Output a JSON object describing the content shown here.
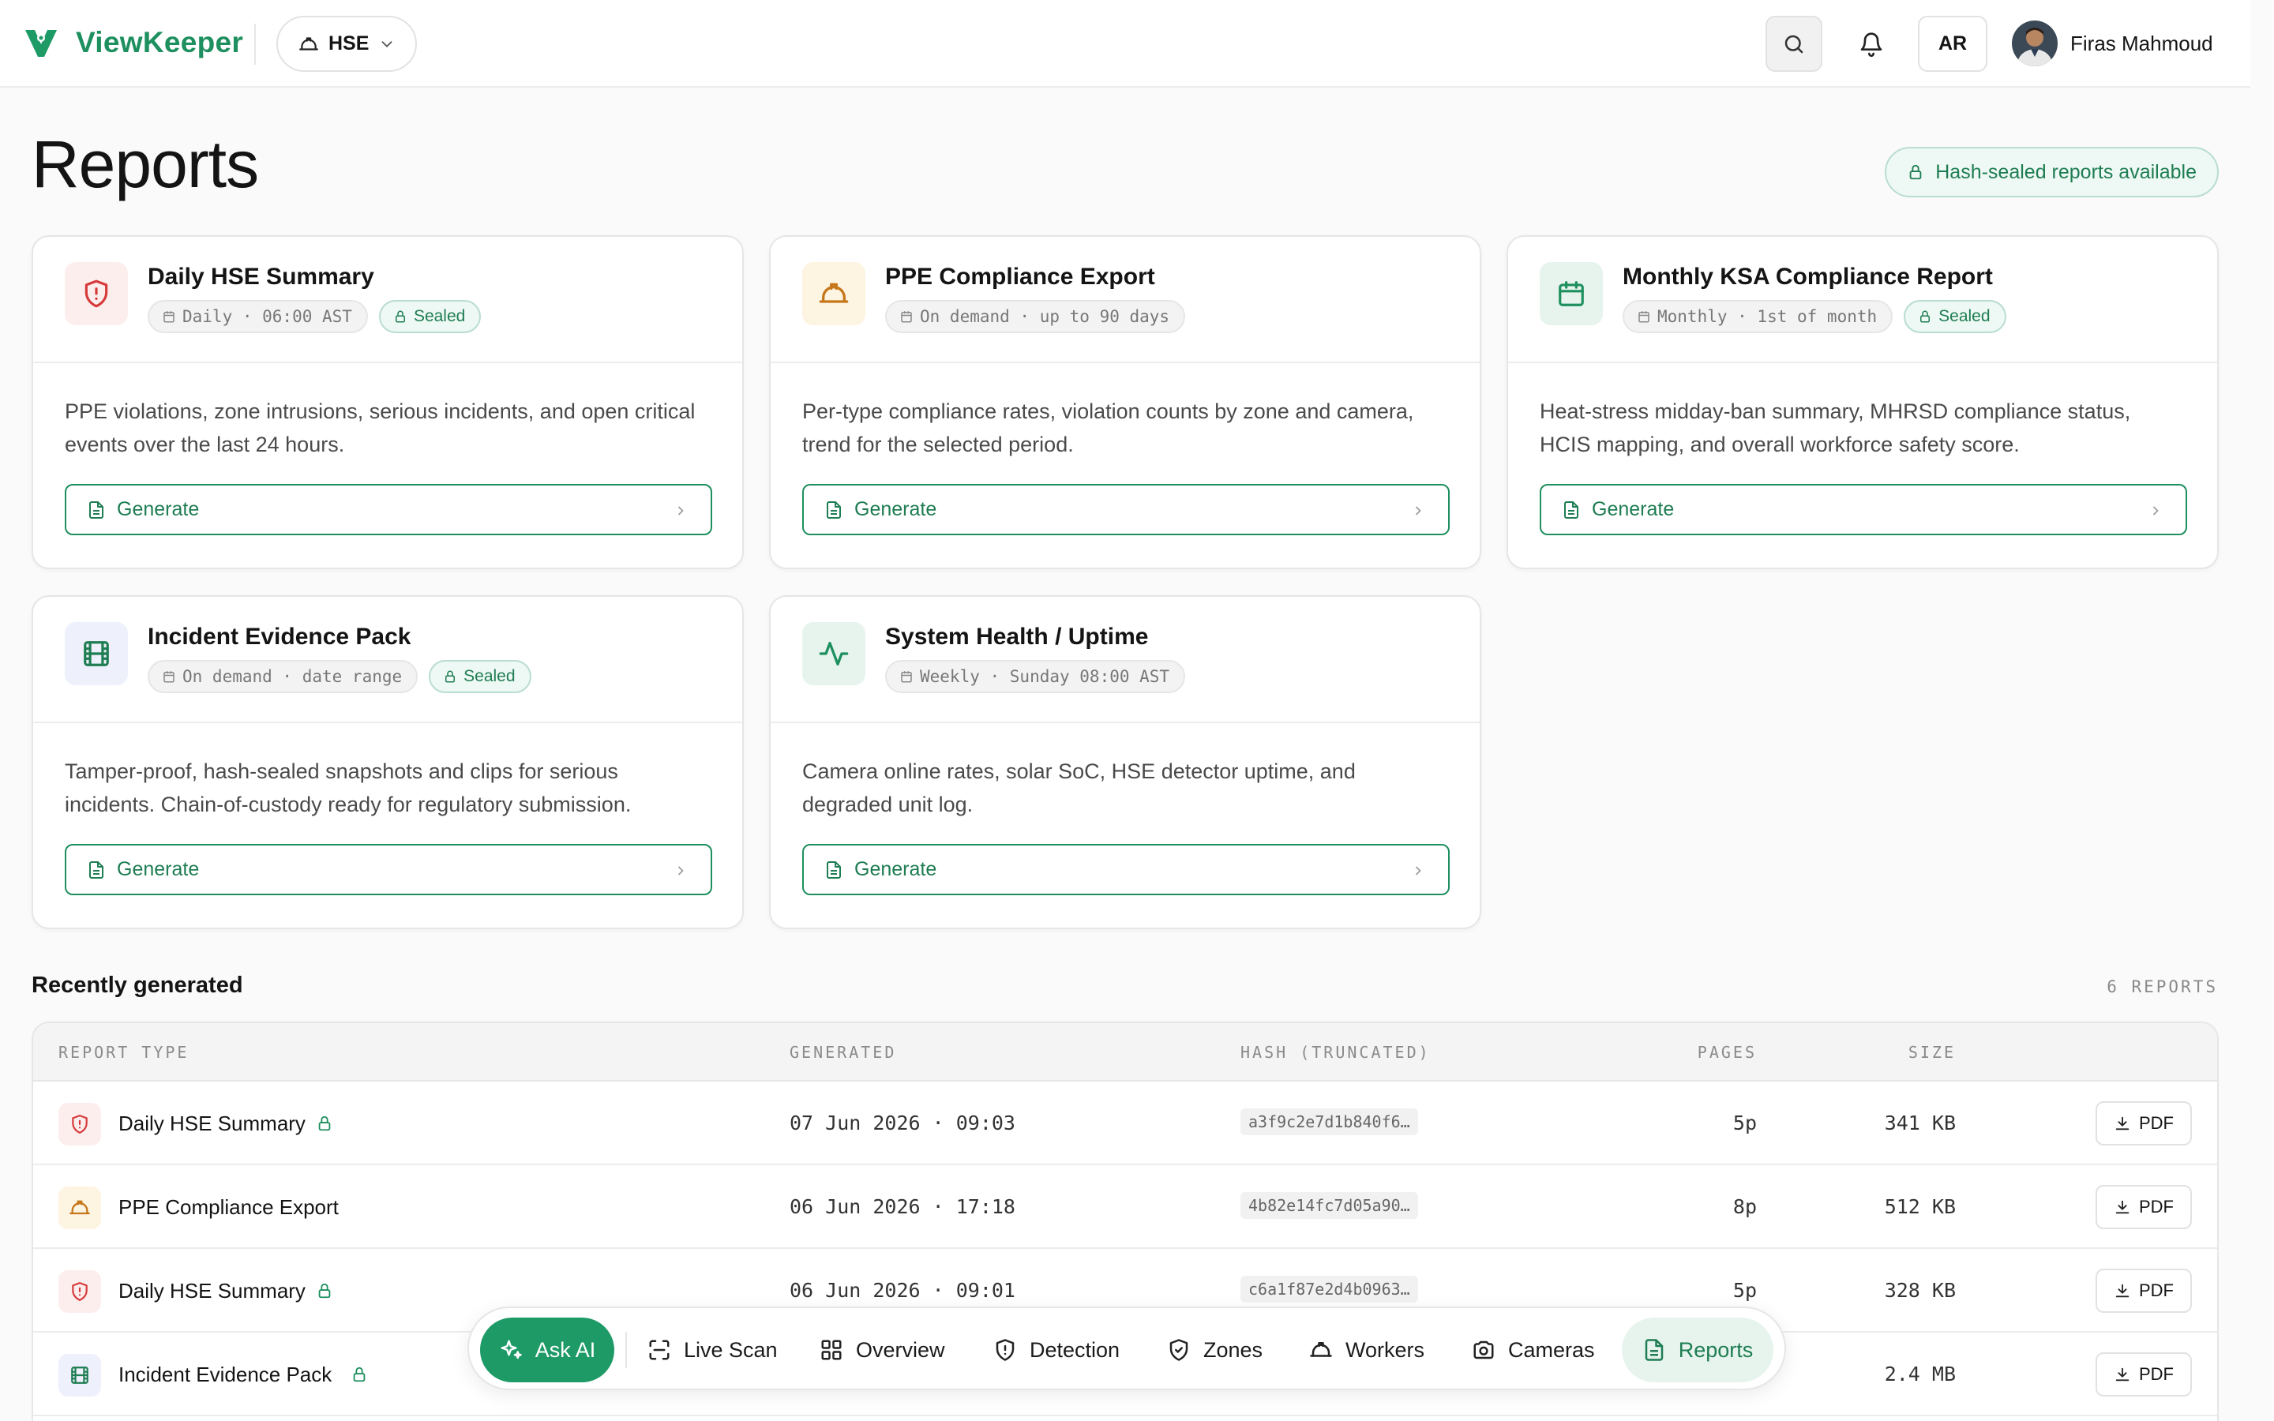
{
  "header": {
    "app_name": "ViewKeeper",
    "site": "HSE",
    "lang_button": "AR",
    "user_name": "Firas Mahmoud"
  },
  "page": {
    "title": "Reports",
    "sealed_badge": "Hash-sealed reports available"
  },
  "cards": [
    {
      "title": "Daily HSE Summary",
      "schedule": "Daily · 06:00 AST",
      "sealed": "Sealed",
      "description": "PPE violations, zone intrusions, serious incidents, and open critical events over the last 24 hours.",
      "button": "Generate",
      "icon": "shield-alert-icon"
    },
    {
      "title": "PPE Compliance Export",
      "schedule": "On demand · up to 90 days",
      "sealed": "",
      "description": "Per-type compliance rates, violation counts by zone and camera, trend for the selected period.",
      "button": "Generate",
      "icon": "hard-hat-icon"
    },
    {
      "title": "Monthly KSA Compliance Report",
      "schedule": "Monthly · 1st of month",
      "sealed": "Sealed",
      "description": "Heat-stress midday-ban summary, MHRSD compliance status, HCIS mapping, and overall workforce safety score.",
      "button": "Generate",
      "icon": "calendar-icon"
    },
    {
      "title": "Incident Evidence Pack",
      "schedule": "On demand · date range",
      "sealed": "Sealed",
      "description": "Tamper-proof, hash-sealed snapshots and clips for serious incidents. Chain-of-custody ready for regulatory submission.",
      "button": "Generate",
      "icon": "film-icon"
    },
    {
      "title": "System Health / Uptime",
      "schedule": "Weekly · Sunday 08:00 AST",
      "sealed": "",
      "description": "Camera online rates, solar SoC, HSE detector uptime, and degraded unit log.",
      "button": "Generate",
      "icon": "activity-icon"
    }
  ],
  "recent": {
    "title": "Recently generated",
    "count": "6 REPORTS",
    "columns": [
      "REPORT TYPE",
      "GENERATED",
      "HASH (TRUNCATED)",
      "PAGES",
      "SIZE"
    ],
    "rows": [
      {
        "type": "Daily HSE Summary",
        "generated": "07 Jun 2026 · 09:03",
        "hash": "a3f9c2e7d1b840f6…",
        "pages": "5p",
        "size": "341 KB",
        "action": "PDF",
        "icon": "shield-alert-icon"
      },
      {
        "type": "PPE Compliance Export",
        "generated": "06 Jun 2026 · 17:18",
        "hash": "4b82e14fc7d05a90…",
        "pages": "8p",
        "size": "512 KB",
        "action": "PDF",
        "icon": "hard-hat-icon"
      },
      {
        "type": "Daily HSE Summary",
        "generated": "06 Jun 2026 · 09:01",
        "hash": "c6a1f87e2d4b0963…",
        "pages": "5p",
        "size": "328 KB",
        "action": "PDF",
        "icon": "shield-alert-icon"
      },
      {
        "type": "Incident Evidence Pack",
        "generated": "",
        "hash": "",
        "pages": "",
        "size": "2.4 MB",
        "action": "PDF",
        "icon": "film-icon"
      }
    ]
  },
  "dock": {
    "ask_ai": "Ask AI",
    "items": [
      "Live Scan",
      "Overview",
      "Detection",
      "Zones",
      "Workers",
      "Cameras",
      "Reports"
    ]
  },
  "colors": {
    "brand": "#1e8f5e",
    "danger": "#d63a3a",
    "warning": "#c7771a",
    "violet": "#1e7d52"
  }
}
